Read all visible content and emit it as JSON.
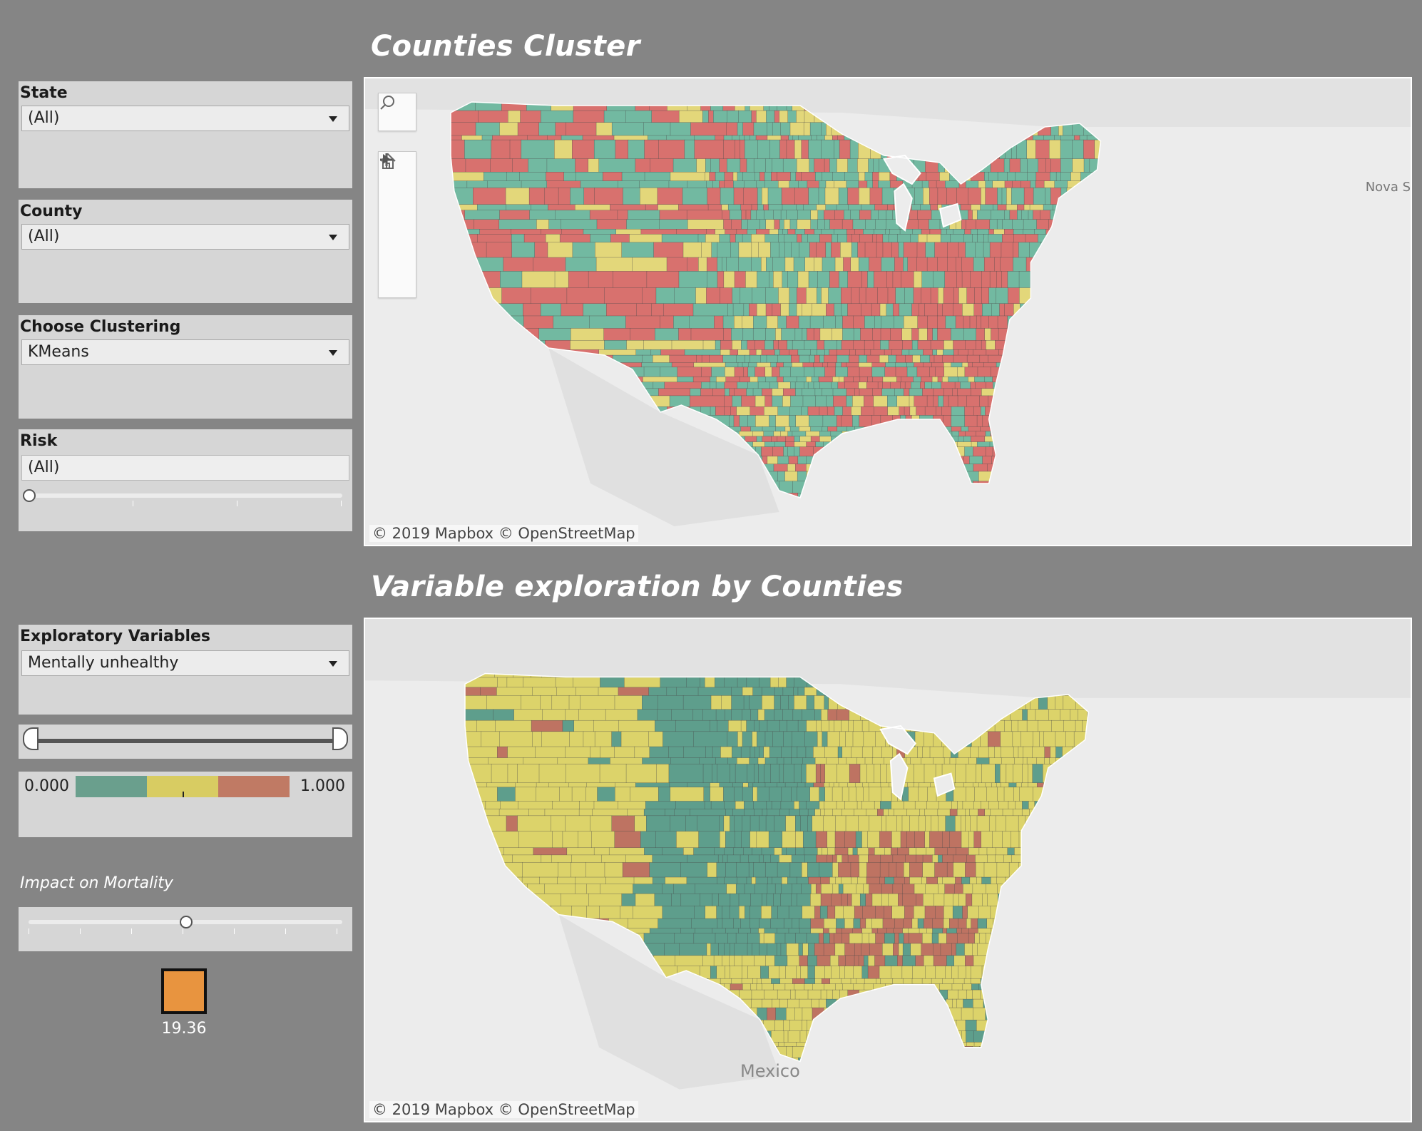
{
  "titles": {
    "cluster": "Counties Cluster",
    "variable": "Variable exploration by Counties"
  },
  "filters": {
    "state": {
      "label": "State",
      "value": "(All)"
    },
    "county": {
      "label": "County",
      "value": "(All)"
    },
    "clustering": {
      "label": "Choose Clustering",
      "value": "KMeans"
    },
    "risk": {
      "label": "Risk",
      "value": "(All)",
      "slider_position": 0
    }
  },
  "exploratory": {
    "label": "Exploratory Variables",
    "value": "Mentally unhealthy",
    "range_min_position": 0,
    "range_max_position": 1,
    "legend": {
      "min": "0.000",
      "max": "1.000",
      "colors": [
        "#6a9f8d",
        "#d8cc62",
        "#c07a64"
      ]
    }
  },
  "impact": {
    "label": "Impact on Mortality",
    "slider_position": 0.5,
    "value": "19.36",
    "swatch_color": "#e8943f"
  },
  "map_top": {
    "attribution": "© 2019 Mapbox  © OpenStreetMap",
    "labels": [
      "Nova S"
    ],
    "colors": {
      "teal": "#72b9a1",
      "yellow": "#e3d77a",
      "red": "#d8716e"
    },
    "controls": [
      "search-icon",
      "zoom-in-icon",
      "zoom-out-icon",
      "home-icon",
      "play-icon"
    ]
  },
  "map_bottom": {
    "attribution": "© 2019 Mapbox  © OpenStreetMap",
    "labels": [
      "Mexico"
    ],
    "colors": {
      "teal": "#5e9e8c",
      "yellow": "#dcd36a",
      "red": "#be7362"
    }
  }
}
